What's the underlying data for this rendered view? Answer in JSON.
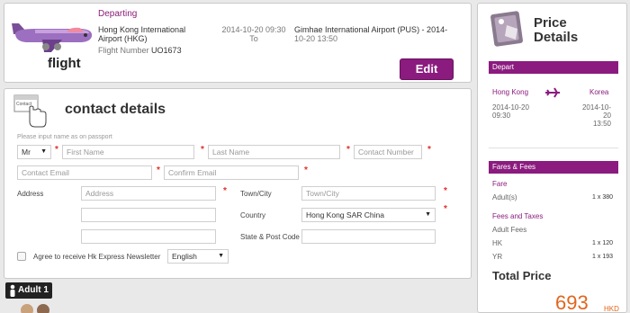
{
  "flight": {
    "label": "flight",
    "departing_label": "Departing",
    "dep_airport": "Hong Kong International Airport (HKG)",
    "dep_time": "2014-10-20 09:30",
    "to_label": "To",
    "arr_airport": "Gimhae International Airport (PUS) - 2014-",
    "arr_time": "10-20 13:50",
    "flight_number_label": "Flight Number",
    "flight_number": "UO1673",
    "edit_label": "Edit"
  },
  "contact": {
    "title": "contact details",
    "hint": "Please input name as on passport",
    "title_select_value": "Mr",
    "first_name_placeholder": "First Name",
    "last_name_placeholder": "Last Name",
    "contact_number_placeholder": "Contact Number",
    "contact_email_placeholder": "Contact Email",
    "confirm_email_placeholder": "Confirm Email",
    "address_label": "Address",
    "address_placeholder": "Address",
    "town_label": "Town/City",
    "town_placeholder": "Town/City",
    "country_label": "Country",
    "country_value": "Hong Kong SAR China",
    "postcode_label": "State & Post Code",
    "newsletter_label": "Agree to receive Hk Express Newsletter",
    "language_value": "English",
    "required_mark": "*"
  },
  "adult": {
    "label": "Adult 1"
  },
  "price": {
    "title_line1": "Price",
    "title_line2": "Details",
    "depart_header": "Depart",
    "from_city": "Hong Kong",
    "to_city": "Korea",
    "from_date": "2014-10-20",
    "from_time": "09:30",
    "to_date": "2014-10-20",
    "to_time": "13:50",
    "fares_header": "Fares & Fees",
    "fare_label": "Fare",
    "adults_label": "Adult(s)",
    "adults_value": "1 x 380",
    "fees_label": "Fees and Taxes",
    "adult_fees_label": "Adult Fees",
    "hk_label": "HK",
    "hk_value": "1 x 120",
    "yr_label": "YR",
    "yr_value": "1 x 193",
    "total_label": "Total Price",
    "total_amount": "693",
    "total_currency": "HKD"
  },
  "colors": {
    "brand_purple": "#8b1b7f",
    "required_red": "#e0302b",
    "total_orange": "#e0661e"
  }
}
